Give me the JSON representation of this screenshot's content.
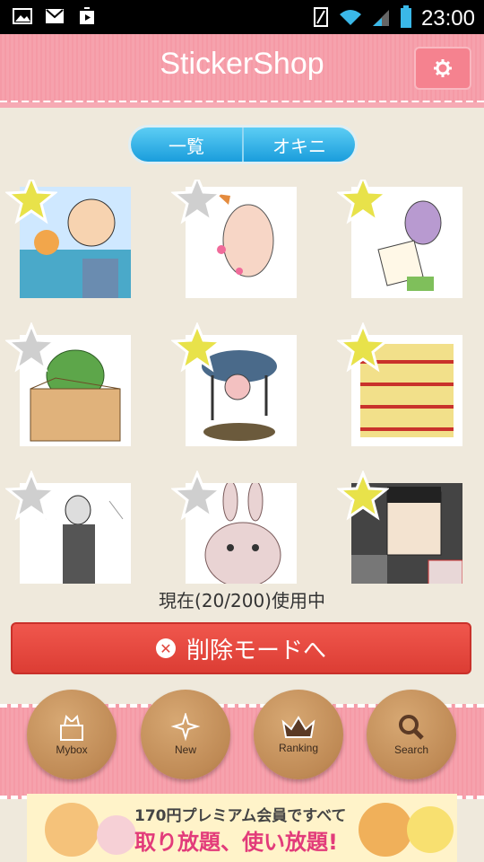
{
  "status_bar": {
    "time": "23:00"
  },
  "header": {
    "title": "StickerShop"
  },
  "tabs": [
    {
      "label": "一覧"
    },
    {
      "label": "オキニ"
    }
  ],
  "stickers": [
    {
      "star": "gold",
      "bg": "#cfe8ff"
    },
    {
      "star": "gray",
      "bg": "#ffffff"
    },
    {
      "star": "gold",
      "bg": "#ffffff"
    },
    {
      "star": "gray",
      "bg": "#ffffff"
    },
    {
      "star": "gold",
      "bg": "#ffffff"
    },
    {
      "star": "gold",
      "bg": "#ffffff"
    },
    {
      "star": "gray",
      "bg": "#ffffff"
    },
    {
      "star": "gray",
      "bg": "#ffffff"
    },
    {
      "star": "gold",
      "bg": "#ffffff"
    }
  ],
  "usage": {
    "text": "現在(20/200)使用中"
  },
  "delete_button": {
    "label": "削除モードへ"
  },
  "nav": [
    {
      "label": "Mybox",
      "icon": "box-cat-icon"
    },
    {
      "label": "New",
      "icon": "sparkle-icon"
    },
    {
      "label": "Ranking",
      "icon": "crown-icon"
    },
    {
      "label": "Search",
      "icon": "magnifier-icon"
    }
  ],
  "banner": {
    "line1": "170円プレミアム会員ですべて",
    "line2": "取り放題、使い放題!"
  }
}
